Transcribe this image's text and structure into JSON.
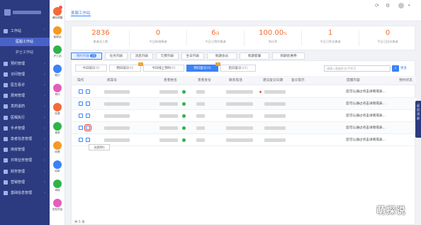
{
  "sidebar": {
    "items": [
      {
        "label": "工作站",
        "type": "parent"
      },
      {
        "label": "医服工作站",
        "type": "sub",
        "active": true
      },
      {
        "label": "护士工作站",
        "type": "sub"
      },
      {
        "label": "预约管理",
        "type": "parent"
      },
      {
        "label": "诊间管理",
        "type": "parent"
      },
      {
        "label": "医生看诊",
        "type": "parent"
      },
      {
        "label": "费用管理",
        "type": "parent"
      },
      {
        "label": "发药退药",
        "type": "parent"
      },
      {
        "label": "医嘱执行",
        "type": "parent"
      },
      {
        "label": "手术管理",
        "type": "parent"
      },
      {
        "label": "患者信息管理",
        "type": "parent"
      },
      {
        "label": "库房管理",
        "type": "parent"
      },
      {
        "label": "日常业务管理",
        "type": "parent"
      },
      {
        "label": "财务管理",
        "type": "parent"
      },
      {
        "label": "营销管理",
        "type": "parent"
      },
      {
        "label": "基础信息管理",
        "type": "parent"
      }
    ]
  },
  "rail": {
    "items": [
      {
        "label": "通知提醒",
        "color": "#f36a3a"
      },
      {
        "label": "客服站",
        "color": "#f59a23"
      },
      {
        "label": "护士站",
        "color": "#2fb34a"
      },
      {
        "label": "登记",
        "color": "#3b82f6"
      },
      {
        "label": "预约",
        "color": "#e45cbd"
      },
      {
        "label": "收费",
        "color": "#f36a3a"
      },
      {
        "label": "报表",
        "color": "#2fb34a"
      },
      {
        "label": "收费",
        "color": "#f59a23"
      },
      {
        "label": "收款",
        "color": "#3b82f6"
      },
      {
        "label": "审核",
        "color": "#2fb34a"
      },
      {
        "label": "发型药品",
        "color": "#e45cbd"
      }
    ]
  },
  "header": {
    "title": "客服工作站"
  },
  "stats": [
    {
      "value": "2836",
      "unit": "",
      "label": "患者总人数"
    },
    {
      "value": "0",
      "unit": "",
      "label": "今日新增患者"
    },
    {
      "value": "6",
      "unit": "月",
      "label": "今日已预约患者"
    },
    {
      "value": "100.00",
      "unit": "%",
      "label": "到诊率"
    },
    {
      "value": "1",
      "unit": "",
      "label": "今日已到诊患者"
    },
    {
      "value": "0",
      "unit": "",
      "label": "今日已回访患者"
    }
  ],
  "tabs": [
    {
      "label": "预约列表",
      "count": "23",
      "active": true
    },
    {
      "label": "任务列表"
    },
    {
      "label": "消息列表"
    },
    {
      "label": "欠费列表"
    },
    {
      "label": "生日列表"
    },
    {
      "label": "到期会员"
    },
    {
      "label": "到期套餐"
    },
    {
      "label": "到期优惠券"
    }
  ],
  "filters": [
    {
      "label": "今日就诊",
      "count": "(0)"
    },
    {
      "label": "明日就诊",
      "count": "(0)",
      "badge": "1"
    },
    {
      "label": "今日线上预约",
      "count": "(0)"
    },
    {
      "label": "明日复诊",
      "count": "(0)",
      "active": true,
      "badge": "1"
    },
    {
      "label": "后日复诊",
      "count": "(21)"
    }
  ],
  "search": {
    "placeholder": "请输入患者姓名/手机号",
    "more": "更多"
  },
  "columns": [
    "操作",
    "病案号",
    "患者姓名",
    "患者身份",
    "联系电话",
    "建议复诊日期",
    "复诊提示",
    "提醒内容",
    "预约状态"
  ],
  "rows": [
    {
      "note": "您可以通过点击详情或表..."
    },
    {
      "note": "您可以通过点击详情或表..."
    },
    {
      "note": "您可以通过点击详情或表..."
    },
    {
      "note": "您可以通过点击详情或表..."
    },
    {
      "note": "您可以通过点击详情或表..."
    }
  ],
  "tooltip": "创建预约",
  "side_tab": "返回顶部",
  "pager": {
    "text": "共 5 条"
  },
  "watermark": "萌探说"
}
